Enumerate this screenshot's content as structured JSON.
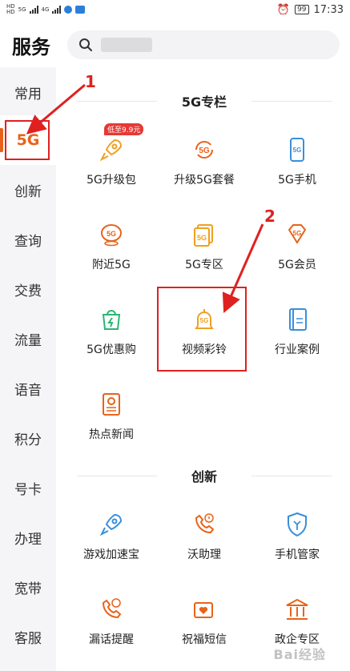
{
  "status_bar": {
    "hd1": "HD",
    "hd2": "HD",
    "net1": "5G",
    "net2": "4G",
    "battery": "99",
    "time": "17:33"
  },
  "header": {
    "title": "服务"
  },
  "sidebar": {
    "items": [
      {
        "label": "常用"
      },
      {
        "label": "5G"
      },
      {
        "label": "创新"
      },
      {
        "label": "查询"
      },
      {
        "label": "交费"
      },
      {
        "label": "流量"
      },
      {
        "label": "语音"
      },
      {
        "label": "积分"
      },
      {
        "label": "号卡"
      },
      {
        "label": "办理"
      },
      {
        "label": "宽带"
      },
      {
        "label": "客服"
      }
    ],
    "active_index": 1
  },
  "sections": [
    {
      "title": "5G专栏",
      "items": [
        {
          "label": "5G升级包",
          "icon": "rocket-icon",
          "badge": "低至9.9元"
        },
        {
          "label": "升级5G套餐",
          "icon": "upgrade-5g-icon"
        },
        {
          "label": "5G手机",
          "icon": "phone-5g-icon"
        },
        {
          "label": "附近5G",
          "icon": "nearby-5g-icon"
        },
        {
          "label": "5G专区",
          "icon": "zone-5g-icon"
        },
        {
          "label": "5G会员",
          "icon": "member-diamond-icon"
        },
        {
          "label": "5G优惠购",
          "icon": "shopping-bag-icon"
        },
        {
          "label": "视频彩铃",
          "icon": "bell-icon"
        },
        {
          "label": "行业案例",
          "icon": "case-book-icon"
        },
        {
          "label": "热点新闻",
          "icon": "news-icon"
        }
      ]
    },
    {
      "title": "创新",
      "items": [
        {
          "label": "游戏加速宝",
          "icon": "rocket-icon"
        },
        {
          "label": "沃助理",
          "icon": "phone-assistant-icon"
        },
        {
          "label": "手机管家",
          "icon": "shield-icon"
        },
        {
          "label": "漏话提醒",
          "icon": "missed-call-icon"
        },
        {
          "label": "祝福短信",
          "icon": "heart-message-icon"
        },
        {
          "label": "政企专区",
          "icon": "government-building-icon"
        }
      ]
    }
  ],
  "annotations": {
    "label1": "1",
    "label2": "2"
  },
  "watermark": "Bai经验"
}
